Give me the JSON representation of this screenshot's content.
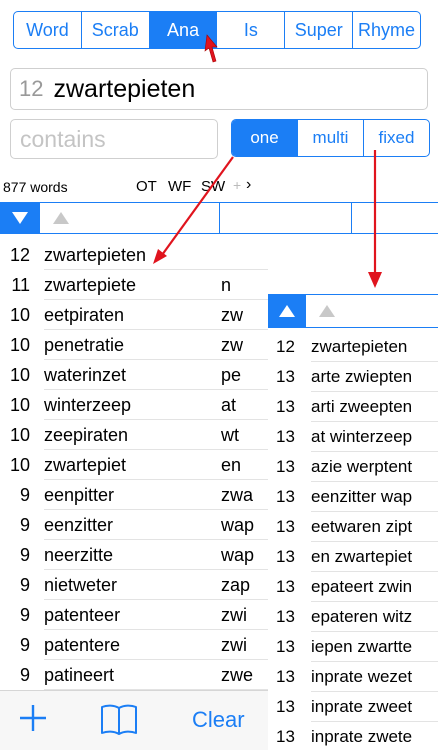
{
  "tabs": [
    {
      "label": "Word",
      "active": false
    },
    {
      "label": "Scrab",
      "active": false
    },
    {
      "label": "Ana",
      "active": true
    },
    {
      "label": "Is",
      "active": false
    },
    {
      "label": "Super",
      "active": false
    },
    {
      "label": "Rhyme",
      "active": false
    }
  ],
  "search": {
    "letter_count": "12",
    "word": "zwartepieten",
    "contains_placeholder": "contains"
  },
  "mode": [
    {
      "label": "one",
      "active": true
    },
    {
      "label": "multi",
      "active": false
    },
    {
      "label": "fixed",
      "active": false
    }
  ],
  "info": {
    "word_count": "877 words",
    "ot": "OT",
    "wf": "WF",
    "sw": "SW",
    "plus": "+",
    "chevron": "›"
  },
  "results": [
    {
      "n": "12",
      "word": "zwartepieten",
      "rest": ""
    },
    {
      "n": "11",
      "word": "zwartepiete",
      "rest": "n"
    },
    {
      "n": "10",
      "word": "eetpiraten",
      "rest": "zw"
    },
    {
      "n": "10",
      "word": "penetratie",
      "rest": "zw"
    },
    {
      "n": "10",
      "word": "waterinzet",
      "rest": "pe"
    },
    {
      "n": "10",
      "word": "winterzeep",
      "rest": "at"
    },
    {
      "n": "10",
      "word": "zeepiraten",
      "rest": "wt"
    },
    {
      "n": "10",
      "word": "zwartepiet",
      "rest": "en"
    },
    {
      "n": "9",
      "word": "eenpitter",
      "rest": "zwa"
    },
    {
      "n": "9",
      "word": "eenzitter",
      "rest": "wap"
    },
    {
      "n": "9",
      "word": "neerzitte",
      "rest": "wap"
    },
    {
      "n": "9",
      "word": "nietweter",
      "rest": "zap"
    },
    {
      "n": "9",
      "word": "patenteer",
      "rest": "zwi"
    },
    {
      "n": "9",
      "word": "patentere",
      "rest": "zwi"
    },
    {
      "n": "9",
      "word": "patineert",
      "rest": "zwe"
    }
  ],
  "multi_results": [
    {
      "n": "12",
      "words": "zwartepieten"
    },
    {
      "n": "13",
      "words": "arte zwiepten"
    },
    {
      "n": "13",
      "words": "arti zweepten"
    },
    {
      "n": "13",
      "words": "at winterzeep"
    },
    {
      "n": "13",
      "words": "azie werptent"
    },
    {
      "n": "13",
      "words": "eenzitter wap"
    },
    {
      "n": "13",
      "words": "eetwaren zipt"
    },
    {
      "n": "13",
      "words": "en zwartepiet"
    },
    {
      "n": "13",
      "words": "epateert zwin"
    },
    {
      "n": "13",
      "words": "epateren witz"
    },
    {
      "n": "13",
      "words": "iepen zwartte"
    },
    {
      "n": "13",
      "words": "inprate wezet"
    },
    {
      "n": "13",
      "words": "inprate zweet"
    },
    {
      "n": "13",
      "words": "inprate zwete"
    }
  ],
  "toolbar": {
    "clear_label": "Clear"
  },
  "colors": {
    "accent": "#1b7ef5",
    "arrow": "#e0141e"
  }
}
